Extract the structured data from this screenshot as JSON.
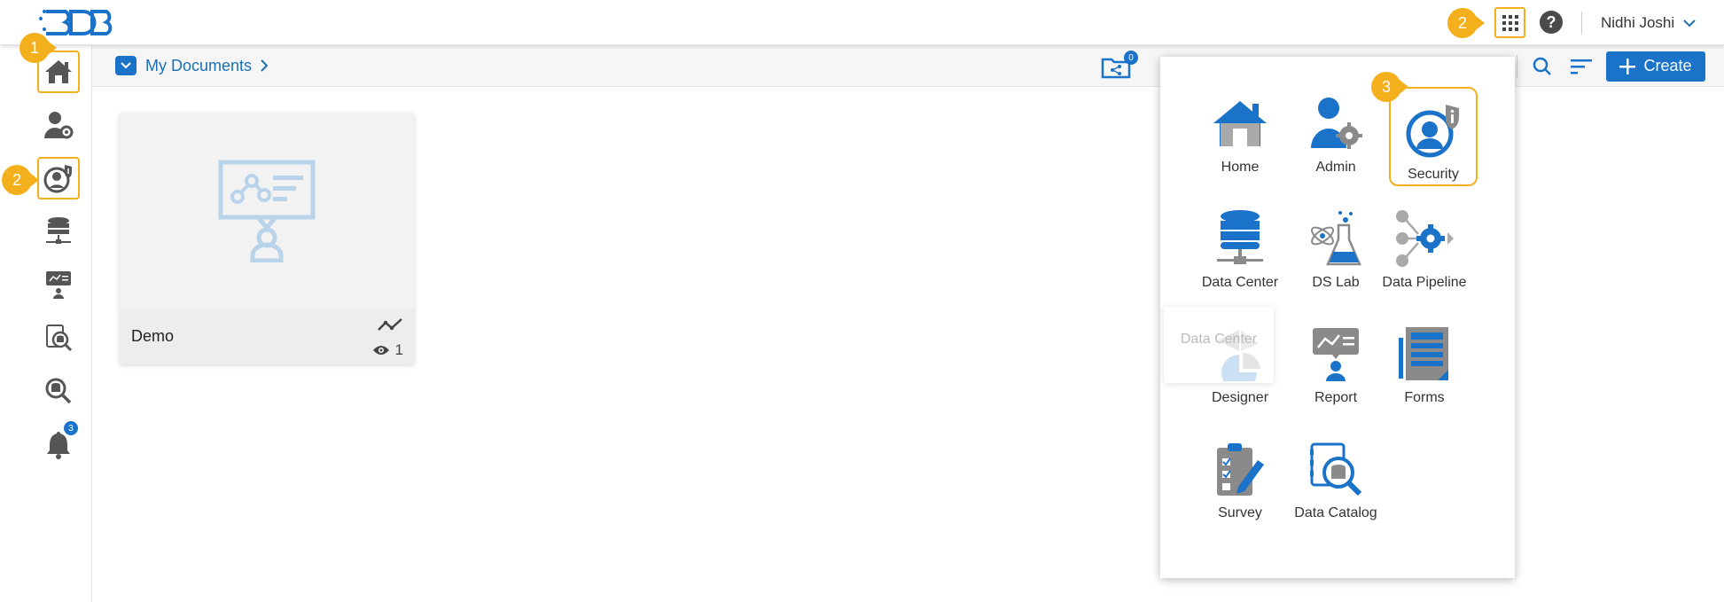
{
  "header": {
    "logo_text": "BDB",
    "apps_icon": "grid-icon",
    "help_icon": "help-icon",
    "user_name": "Nidhi Joshi"
  },
  "sidebar": {
    "items": [
      {
        "name": "home",
        "icon": "home-icon",
        "active": true
      },
      {
        "name": "admin",
        "icon": "admin-user-gear-icon",
        "active": false
      },
      {
        "name": "security",
        "icon": "security-shield-user-icon",
        "active": true
      },
      {
        "name": "data-center",
        "icon": "database-icon",
        "active": false
      },
      {
        "name": "report",
        "icon": "report-presentation-icon",
        "active": false
      },
      {
        "name": "data-catalog",
        "icon": "data-catalog-icon",
        "active": false
      },
      {
        "name": "data-search",
        "icon": "search-database-icon",
        "active": false
      },
      {
        "name": "notifications",
        "icon": "bell-icon",
        "active": false,
        "badge": "3"
      }
    ]
  },
  "callouts": {
    "home": "1",
    "security": "2",
    "apps": "2",
    "security_app": "3"
  },
  "breadcrumb": {
    "label": "My Documents"
  },
  "toolbar": {
    "shared_badge": "0",
    "create_label": "Create"
  },
  "documents": [
    {
      "title": "Demo",
      "views": "1"
    }
  ],
  "app_menu": {
    "tiles": [
      {
        "label": "Home",
        "icon": "home-icon"
      },
      {
        "label": "Admin",
        "icon": "admin-icon"
      },
      {
        "label": "Security",
        "icon": "security-icon"
      },
      {
        "label": "Data Center",
        "icon": "data-center-icon"
      },
      {
        "label": "DS Lab",
        "icon": "ds-lab-icon"
      },
      {
        "label": "Data Pipeline",
        "icon": "data-pipeline-icon"
      },
      {
        "label": "Designer",
        "icon": "designer-icon"
      },
      {
        "label": "Report",
        "icon": "report-icon"
      },
      {
        "label": "Forms",
        "icon": "forms-icon"
      },
      {
        "label": "Survey",
        "icon": "survey-icon"
      },
      {
        "label": "Data Catalog",
        "icon": "data-catalog-icon"
      }
    ],
    "ghost_label": "Data Center"
  },
  "colors": {
    "accent": "#1a73c8",
    "highlight": "#f4b01c",
    "icon_grey": "#555555"
  }
}
